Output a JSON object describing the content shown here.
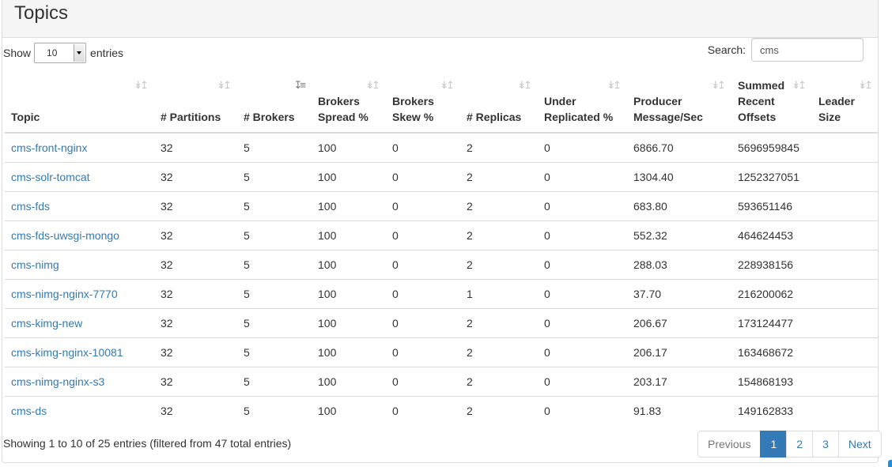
{
  "panel": {
    "title": "Topics"
  },
  "length": {
    "prefix": "Show",
    "value": "10",
    "suffix": "entries"
  },
  "search": {
    "label": "Search:",
    "value": "cms"
  },
  "columns": [
    {
      "label": "Topic",
      "sort": "both"
    },
    {
      "label": "# Partitions",
      "sort": "both"
    },
    {
      "label": "# Brokers",
      "sort": "desc"
    },
    {
      "label": "Brokers Spread %",
      "sort": "both"
    },
    {
      "label": "Brokers Skew %",
      "sort": "both"
    },
    {
      "label": "# Replicas",
      "sort": "both"
    },
    {
      "label": "Under Replicated %",
      "sort": "both"
    },
    {
      "label": "Producer Message/Sec",
      "sort": "both"
    },
    {
      "label": "Summed Recent Offsets",
      "sort": "both"
    },
    {
      "label": "Leader Size",
      "sort": "both"
    }
  ],
  "rows": [
    {
      "topic": "cms-front-nginx",
      "partitions": "32",
      "brokers": "5",
      "spread": "100",
      "skew": "0",
      "replicas": "2",
      "under": "0",
      "producer": "6866.70",
      "offsets": "5696959845",
      "leader": ""
    },
    {
      "topic": "cms-solr-tomcat",
      "partitions": "32",
      "brokers": "5",
      "spread": "100",
      "skew": "0",
      "replicas": "2",
      "under": "0",
      "producer": "1304.40",
      "offsets": "1252327051",
      "leader": ""
    },
    {
      "topic": "cms-fds",
      "partitions": "32",
      "brokers": "5",
      "spread": "100",
      "skew": "0",
      "replicas": "2",
      "under": "0",
      "producer": "683.80",
      "offsets": "593651146",
      "leader": ""
    },
    {
      "topic": "cms-fds-uwsgi-mongo",
      "partitions": "32",
      "brokers": "5",
      "spread": "100",
      "skew": "0",
      "replicas": "2",
      "under": "0",
      "producer": "552.32",
      "offsets": "464624453",
      "leader": ""
    },
    {
      "topic": "cms-nimg",
      "partitions": "32",
      "brokers": "5",
      "spread": "100",
      "skew": "0",
      "replicas": "2",
      "under": "0",
      "producer": "288.03",
      "offsets": "228938156",
      "leader": ""
    },
    {
      "topic": "cms-nimg-nginx-7770",
      "partitions": "32",
      "brokers": "5",
      "spread": "100",
      "skew": "0",
      "replicas": "1",
      "under": "0",
      "producer": "37.70",
      "offsets": "216200062",
      "leader": ""
    },
    {
      "topic": "cms-kimg-new",
      "partitions": "32",
      "brokers": "5",
      "spread": "100",
      "skew": "0",
      "replicas": "2",
      "under": "0",
      "producer": "206.67",
      "offsets": "173124477",
      "leader": ""
    },
    {
      "topic": "cms-kimg-nginx-10081",
      "partitions": "32",
      "brokers": "5",
      "spread": "100",
      "skew": "0",
      "replicas": "2",
      "under": "0",
      "producer": "206.17",
      "offsets": "163468672",
      "leader": ""
    },
    {
      "topic": "cms-nimg-nginx-s3",
      "partitions": "32",
      "brokers": "5",
      "spread": "100",
      "skew": "0",
      "replicas": "2",
      "under": "0",
      "producer": "203.17",
      "offsets": "154868193",
      "leader": ""
    },
    {
      "topic": "cms-ds",
      "partitions": "32",
      "brokers": "5",
      "spread": "100",
      "skew": "0",
      "replicas": "2",
      "under": "0",
      "producer": "91.83",
      "offsets": "149162833",
      "leader": ""
    }
  ],
  "info": "Showing 1 to 10 of 25 entries (filtered from 47 total entries)",
  "pagination": {
    "previous": "Previous",
    "pages": [
      "1",
      "2",
      "3"
    ],
    "active_page": "1",
    "next": "Next"
  },
  "colors": {
    "link": "#337ab7",
    "active_page_bg": "#337ab7",
    "heading_bg": "#f5f5f5",
    "border": "#dddddd"
  }
}
